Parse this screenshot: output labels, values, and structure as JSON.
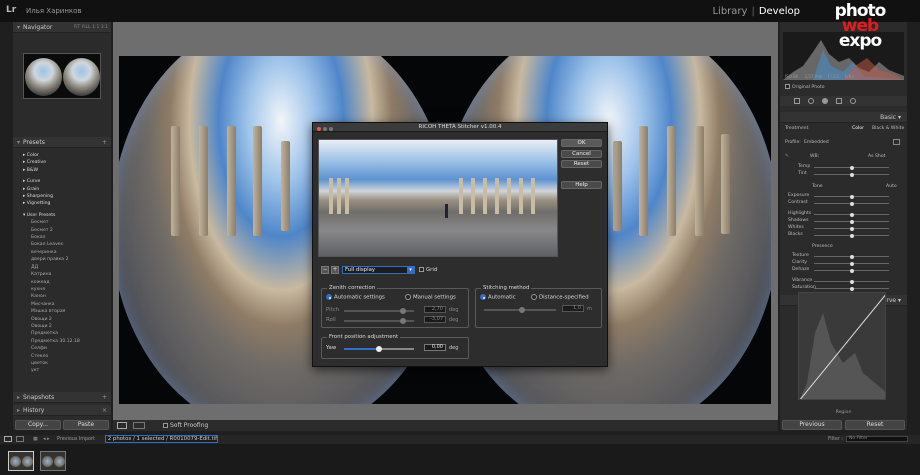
{
  "app": {
    "logo": "Lr",
    "user": "Илья Харинков",
    "module_library": "Library",
    "module_develop": "Develop",
    "divider": "|"
  },
  "watermark": {
    "line1": "photo",
    "line2": "web",
    "line3": "expo"
  },
  "navigator": {
    "title": "Navigator",
    "fit": "FIT",
    "fill": "FILL",
    "z1": "1:1",
    "z2": "3:1"
  },
  "presets": {
    "title": "Presets",
    "groups": [
      "Color",
      "Creative",
      "B&W",
      "Curve",
      "Grain",
      "Sharpening",
      "Vignetting"
    ],
    "user_title": "User Presets",
    "user_items": [
      "Бесмет",
      "Бесмет 2",
      "Бокал",
      "Бокал Leaves",
      "вечеринка",
      "двери правка 2",
      "ДД",
      "Катрина",
      "кожеад",
      "кухня",
      "Канон",
      "Мисчанка",
      "Мэшка вторая",
      "Овощи 2",
      "Овощи 2",
      "Предметка",
      "Предметка 30.12.18",
      "Селфи",
      "Стекло",
      "цветок",
      "укт"
    ]
  },
  "snapshots": {
    "title": "Snapshots"
  },
  "history": {
    "title": "History"
  },
  "left_buttons": {
    "copy": "Copy...",
    "paste": "Paste"
  },
  "toolbar": {
    "soft_proofing": "Soft Proofing"
  },
  "right_panel": {
    "histogram_info": [
      "ISO 80",
      "2,57 mm",
      "f / 2,1",
      "1/4 с"
    ],
    "original_photo": "Original Photo",
    "basic_title": "Basic",
    "treatment": "Treatment",
    "treatment_color": "Color",
    "treatment_bw": "Black & White",
    "profile": "Profile:",
    "profile_value": "Embedded",
    "wb": "WB:",
    "wb_value": "As Shot",
    "temp": "Temp",
    "tint": "Tint",
    "tone": "Tone",
    "tone_auto": "Auto",
    "exposure": "Exposure",
    "contrast": "Contrast",
    "highlights": "Highlights",
    "shadows": "Shadows",
    "whites": "Whites",
    "blacks": "Blacks",
    "presence": "Presence",
    "texture": "Texture",
    "clarity": "Clarity",
    "dehaze": "Dehaze",
    "vibrance": "Vibrance",
    "saturation": "Saturation",
    "tone_curve_title": "Tone Curve",
    "region": "Region"
  },
  "right_buttons": {
    "previous": "Previous",
    "reset": "Reset"
  },
  "filmstrip": {
    "source": "Previous Import",
    "selection": "2 photos / 1 selected / R0010079-Edit.tif",
    "filter_label": "Filter :",
    "filter_value": "No Filter"
  },
  "dialog": {
    "title": "RICOH THETA Stitcher v1.00.4",
    "ok": "OK",
    "cancel": "Cancel",
    "reset": "Reset",
    "help": "Help",
    "zoom_minus": "−",
    "zoom_plus": "+",
    "display_value": "Full display",
    "grid": "Grid",
    "zenith": {
      "title": "Zenith correction",
      "automatic": "Automatic settings",
      "manual": "Manual settings",
      "pitch": "Pitch",
      "pitch_value": "2,70",
      "roll": "Roll",
      "roll_value": "-3,07",
      "unit": "deg"
    },
    "stitching": {
      "title": "Stitching method",
      "automatic": "Automatic",
      "distance": "Distance-specified",
      "value": "1,0",
      "unit": "m"
    },
    "front": {
      "title": "Front position adjustment",
      "yaw": "Yaw",
      "yaw_value": "0,00",
      "unit": "deg",
      "yaw_level": 0.5
    }
  }
}
